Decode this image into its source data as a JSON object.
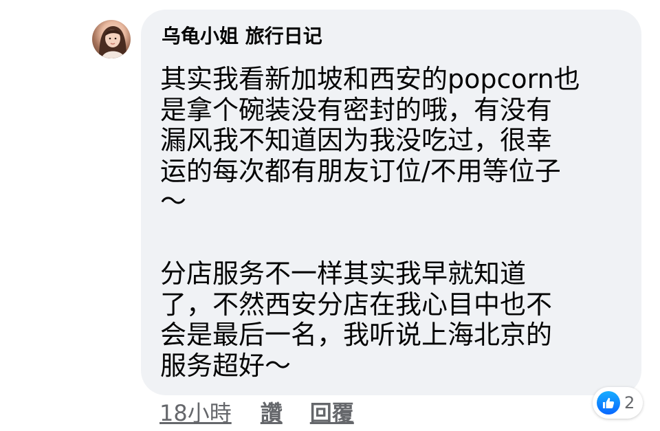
{
  "comment": {
    "author": "乌龟小姐 旅行日记",
    "paragraph1": [
      "其实我看新加坡和西安的popcorn也",
      "是拿个碗装没有密封的哦，有没有",
      "漏风我不知道因为我没吃过，很幸",
      "运的每次都有朋友订位/不用等位子",
      "～"
    ],
    "paragraph2": [
      "分店服务不一样其实我早就知道",
      "了，不然西安分店在我心目中也不",
      "会是最后一名，我听说上海北京的",
      "服务超好～"
    ]
  },
  "footer": {
    "time": "18小時",
    "like_label": "讚",
    "reply_label": "回覆"
  },
  "reaction": {
    "icon": "like-icon",
    "count": "2",
    "color": "#0866ff"
  },
  "colors": {
    "bubble": "#f0f2f5",
    "text": "#050505",
    "secondary": "#65676b"
  }
}
